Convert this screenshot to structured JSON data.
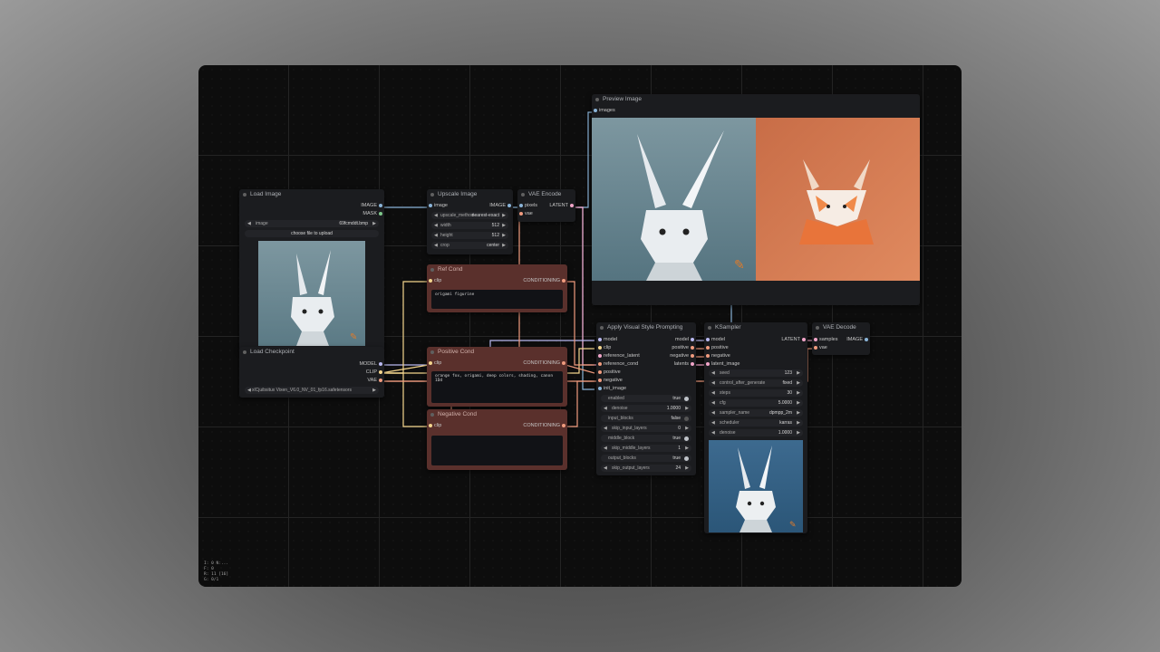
{
  "colors": {
    "canvas_bg": "#0d0d0d",
    "node_bg": "#1b1c1f",
    "cond_node_bg": "#5a302c",
    "wire_image": "#8ab4d8",
    "wire_cond": "#f09b7e",
    "wire_clip": "#f4d58d",
    "wire_model": "#b9b9f0",
    "wire_latent": "#f1a5c8"
  },
  "nodes": {
    "load_image": {
      "title": "Load Image",
      "outputs": [
        "IMAGE",
        "MASK"
      ],
      "image_label": "image",
      "image_value": "69fcmddt.bmp",
      "upload_button": "choose file to upload"
    },
    "load_checkpoint": {
      "title": "Load Checkpoint",
      "outputs": [
        "MODEL",
        "CLIP",
        "VAE"
      ],
      "ckpt_value": "xlCjuibsitux Vixen_V6.0_NV_01_fp16.safetensors"
    },
    "upscale_image": {
      "title": "Upscale Image",
      "input": "image",
      "output": "IMAGE",
      "widgets": [
        {
          "label": "upscale_method",
          "value": "nearest-exact"
        },
        {
          "label": "width",
          "value": "512"
        },
        {
          "label": "height",
          "value": "512"
        },
        {
          "label": "crop",
          "value": "center"
        }
      ]
    },
    "vae_encode": {
      "title": "VAE Encode",
      "inputs": [
        "pixels",
        "vae"
      ],
      "output": "LATENT"
    },
    "ref_cond": {
      "title": "Ref Cond",
      "input": "clip",
      "output": "CONDITIONING",
      "text": "origami figurine"
    },
    "positive_cond": {
      "title": "Positive Cond",
      "input": "clip",
      "output": "CONDITIONING",
      "text": "orange fox, origami, deep colors, shading, canon 1Dd"
    },
    "negative_cond": {
      "title": "Negative Cond",
      "input": "clip",
      "output": "CONDITIONING",
      "text": ""
    },
    "preview_image": {
      "title": "Preview Image",
      "input": "images"
    },
    "apply_style": {
      "title": "Apply Visual Style Prompting",
      "inputs": [
        "model",
        "clip",
        "reference_latent",
        "reference_cond",
        "positive",
        "negative",
        "init_image"
      ],
      "outputs": [
        "model",
        "positive",
        "negative",
        "latents"
      ],
      "widgets": [
        {
          "type": "toggle",
          "label": "enabled",
          "value": "true"
        },
        {
          "type": "number",
          "label": "denoise",
          "value": "1.0000"
        },
        {
          "type": "toggle",
          "label": "input_blocks",
          "value": "false",
          "off": true
        },
        {
          "type": "number",
          "label": "skip_input_layers",
          "value": "0"
        },
        {
          "type": "toggle",
          "label": "middle_block",
          "value": "true"
        },
        {
          "type": "number",
          "label": "skip_middle_layers",
          "value": "1"
        },
        {
          "type": "toggle",
          "label": "output_blocks",
          "value": "true"
        },
        {
          "type": "number",
          "label": "skip_output_layers",
          "value": "24"
        }
      ]
    },
    "ksampler": {
      "title": "KSampler",
      "inputs": [
        "model",
        "positive",
        "negative",
        "latent_image"
      ],
      "output": "LATENT",
      "widgets": [
        {
          "label": "seed",
          "value": "123"
        },
        {
          "label": "control_after_generate",
          "value": "fixed"
        },
        {
          "label": "steps",
          "value": "30"
        },
        {
          "label": "cfg",
          "value": "5.0000"
        },
        {
          "label": "sampler_name",
          "value": "dpmpp_2m"
        },
        {
          "label": "scheduler",
          "value": "karras"
        },
        {
          "label": "denoise",
          "value": "1.0000"
        }
      ]
    },
    "vae_decode": {
      "title": "VAE Decode",
      "inputs": [
        "samples",
        "vae"
      ],
      "output": "IMAGE"
    }
  },
  "stats": [
    "I: 0 N:...",
    "F: 0",
    "R: 11 [16]",
    "G: 0/1",
    "FPS: 60.00"
  ],
  "icons": {
    "edit": "pencil-icon"
  }
}
